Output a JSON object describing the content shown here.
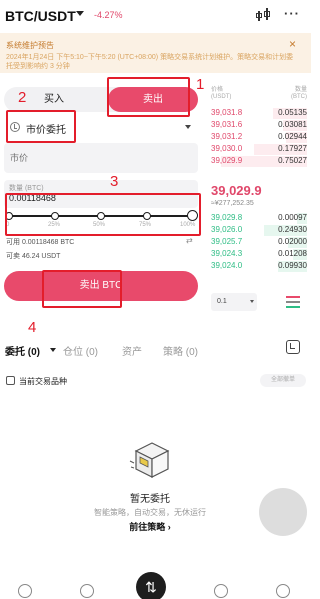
{
  "header": {
    "pair": "BTC/USDT",
    "change": "-4.27%"
  },
  "notice": {
    "title": "系统维护预告",
    "close": "×",
    "body": "2024年1月24日 下午5:10~下午5:20 (UTC+08:00) 策略交易系统计划维护。策略交易和计划委托受到影响约 3 分钟"
  },
  "trade_tabs": {
    "buy": "买入",
    "sell": "卖出"
  },
  "order_type": {
    "label": "市价委托"
  },
  "price_input": {
    "placeholder": "市价"
  },
  "quantity": {
    "label": "数量 (BTC)",
    "value": "0.00118468",
    "ticks": [
      "0",
      "25%",
      "50%",
      "75%",
      "100%"
    ],
    "percent": 100
  },
  "available": {
    "sellable": "可用 0.00118468 BTC",
    "usdt": "可卖 46.24 USDT",
    "transfer": "⇄"
  },
  "sell_button": "卖出 BTC",
  "orderbook": {
    "header_price": "价格\n(USDT)",
    "header_qty": "数量\n(BTC)",
    "asks": [
      {
        "price": "39,031.8",
        "qty": "0.05135",
        "depth": 0.35
      },
      {
        "price": "39,031.6",
        "qty": "0.03081",
        "depth": 0.25
      },
      {
        "price": "39,031.2",
        "qty": "0.02944",
        "depth": 0.22
      },
      {
        "price": "39,030.0",
        "qty": "0.17927",
        "depth": 0.55
      },
      {
        "price": "39,029.9",
        "qty": "0.75027",
        "depth": 0.9
      }
    ],
    "mid_price": "39,029.9",
    "mid_fiat": "≈¥277,252.35",
    "bids": [
      {
        "price": "39,029.8",
        "qty": "0.00097",
        "depth": 0.1
      },
      {
        "price": "39,026.0",
        "qty": "0.24930",
        "depth": 0.45
      },
      {
        "price": "39,025.7",
        "qty": "0.02000",
        "depth": 0.2
      },
      {
        "price": "39,024.3",
        "qty": "0.01208",
        "depth": 0.15
      },
      {
        "price": "39,024.0",
        "qty": "0.09930",
        "depth": 0.3
      }
    ],
    "decimal": "0.1"
  },
  "annotations": [
    "1",
    "2",
    "3",
    "4"
  ],
  "bottom_tabs": {
    "orders": "委托 (0)",
    "positions": "仓位 (0)",
    "assets": "资产",
    "strategy": "策略 (0)"
  },
  "filter": {
    "current_pair": "当前交易品种",
    "cancel_all": "全部撤单"
  },
  "empty": {
    "title": "暂无委托",
    "subtitle": "智能策略，自动交易，无休运行",
    "link": "前往策略 ›"
  },
  "nav": {
    "center": "⇅"
  },
  "colors": {
    "sell": "#e84a6b",
    "buy": "#2ebd85",
    "annotation": "#e31d2b"
  }
}
